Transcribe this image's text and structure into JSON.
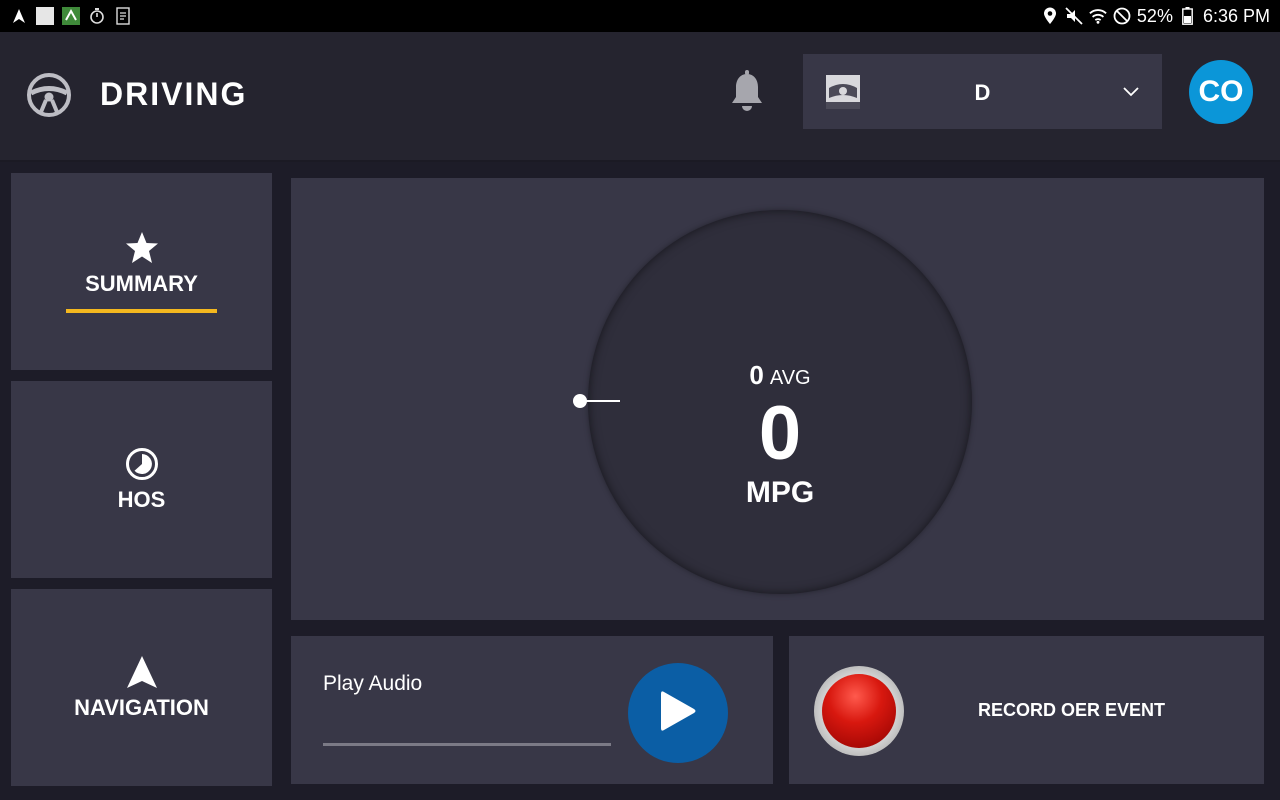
{
  "statusbar": {
    "battery": "52%",
    "time": "6:36 PM"
  },
  "header": {
    "title": "DRIVING",
    "vehicle_select": {
      "value": "D"
    },
    "avatar_initials": "CO"
  },
  "nav": {
    "items": [
      {
        "label": "SUMMARY",
        "icon": "star-icon",
        "active": true
      },
      {
        "label": "HOS",
        "icon": "clock-icon",
        "active": false
      },
      {
        "label": "NAVIGATION",
        "icon": "navigation-arrow-icon",
        "active": false
      }
    ]
  },
  "gauge": {
    "avg_value": "0",
    "avg_label": "AVG",
    "value": "0",
    "unit": "MPG"
  },
  "audio": {
    "label": "Play Audio"
  },
  "record": {
    "label": "RECORD OER EVENT"
  },
  "colors": {
    "accent_underline": "#f4b81f",
    "avatar": "#0b96d8",
    "play_button": "#0b5ea5",
    "record_red": "#d8180f",
    "panel": "#383747",
    "background": "#1d1c28"
  }
}
